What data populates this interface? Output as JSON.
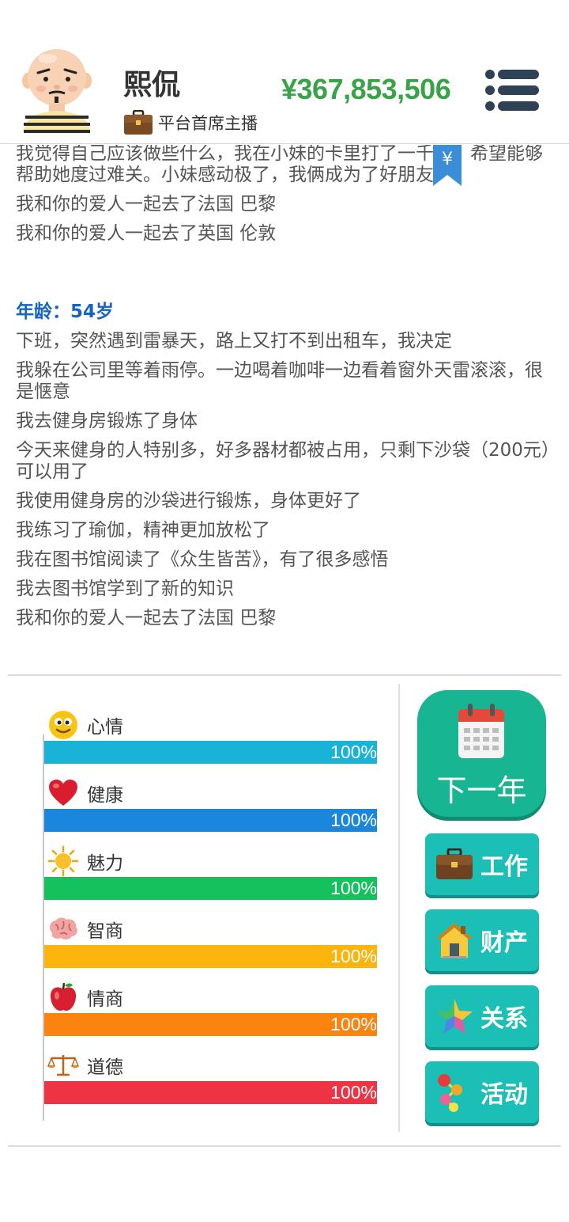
{
  "header": {
    "username": "熙侃",
    "job_title": "平台首席主播",
    "money": "¥367,853,506"
  },
  "log": {
    "entries_before": [
      "我觉得自己应该做些什么，我在小妹的卡里打了一千元，希望能够帮助她度过难关。小妹感动极了，我俩成为了好朋友",
      "我和你的爱人一起去了法国 巴黎",
      "我和你的爱人一起去了英国 伦敦"
    ],
    "age_label": "年龄：54岁",
    "entries": [
      "下班，突然遇到雷暴天，路上又打不到出租车，我决定",
      "我躲在公司里等着雨停。一边喝着咖啡一边看着窗外天雷滚滚，很是惬意",
      "我去健身房锻炼了身体",
      "今天来健身的人特别多，好多器材都被占用，只剩下沙袋（200元）可以用了",
      "我使用健身房的沙袋进行锻炼，身体更好了",
      "我练习了瑜伽，精神更加放松了",
      "我在图书馆阅读了《众生皆苦》，有了很多感悟",
      "我去图书馆学到了新的知识",
      "我和你的爱人一起去了法国 巴黎"
    ],
    "bookmark_symbol": "¥"
  },
  "stats": [
    {
      "label": "心情",
      "icon": "smiley-icon",
      "value": 1.0,
      "pct_text": "100%",
      "color": "#1ab3d8"
    },
    {
      "label": "健康",
      "icon": "heart-icon",
      "value": 1.0,
      "pct_text": "100%",
      "color": "#1a86dc"
    },
    {
      "label": "魅力",
      "icon": "sun-icon",
      "value": 1.0,
      "pct_text": "100%",
      "color": "#15c15d"
    },
    {
      "label": "智商",
      "icon": "brain-icon",
      "value": 1.0,
      "pct_text": "100%",
      "color": "#fdb50e"
    },
    {
      "label": "情商",
      "icon": "apple-icon",
      "value": 1.0,
      "pct_text": "100%",
      "color": "#fb8410"
    },
    {
      "label": "道德",
      "icon": "scales-icon",
      "value": 1.0,
      "pct_text": "100%",
      "color": "#ee3444"
    }
  ],
  "actions": {
    "next_year": "下一年",
    "work": "工作",
    "property": "财产",
    "relations": "关系",
    "activities": "活动"
  }
}
